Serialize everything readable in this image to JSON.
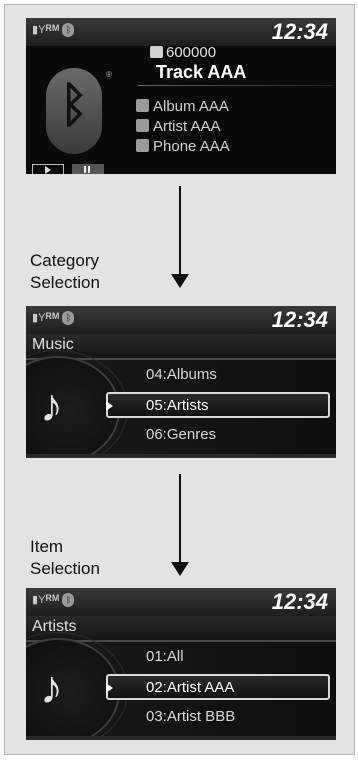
{
  "screens": {
    "now_playing": {
      "clock": "12:34",
      "rm_label": "RM",
      "track_number": "600000",
      "track_title": "Track AAA",
      "album": "Album AAA",
      "artist": "Artist AAA",
      "phone": "Phone AAA"
    },
    "category": {
      "clock": "12:34",
      "rm_label": "RM",
      "title": "Music",
      "items": [
        "04:Albums",
        "05:Artists",
        "06:Genres"
      ],
      "selected_index": 1
    },
    "item": {
      "clock": "12:34",
      "rm_label": "RM",
      "title": "Artists",
      "items": [
        "01:All",
        "02:Artist AAA",
        "03:Artist BBB"
      ],
      "selected_index": 1
    }
  },
  "labels": {
    "category_selection_line1": "Category",
    "category_selection_line2": "Selection",
    "item_selection_line1": "Item",
    "item_selection_line2": "Selection"
  },
  "colors": {
    "screen_bg": "#0a0a0a",
    "text": "#e8e8e8",
    "frame_bg": "#e3e3e3"
  }
}
